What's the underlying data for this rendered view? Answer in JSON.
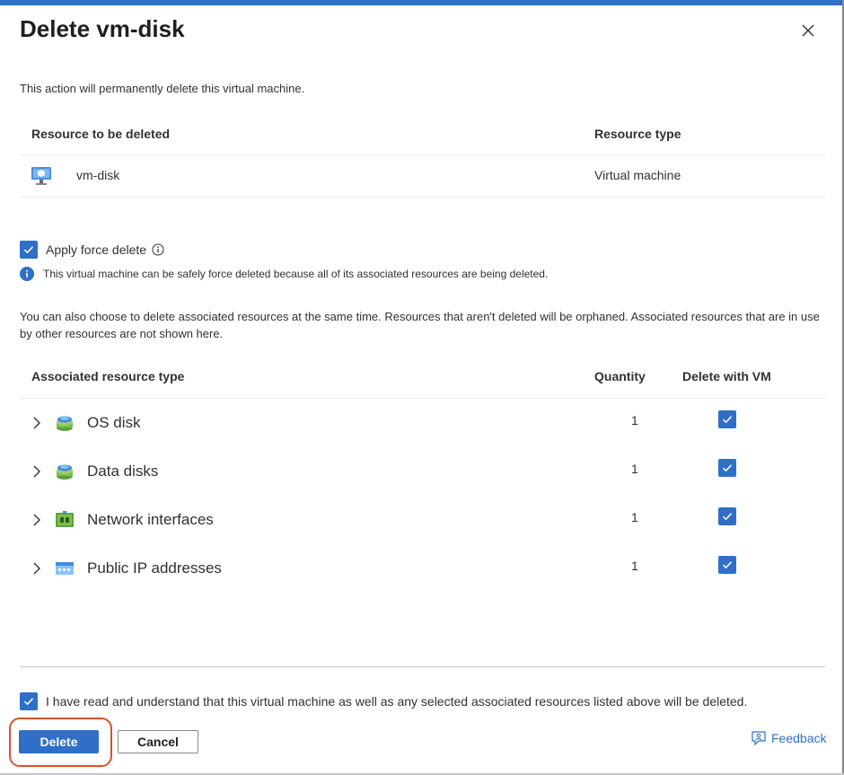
{
  "dialog": {
    "title": "Delete vm-disk",
    "intro": "This action will permanently delete this virtual machine."
  },
  "resource_table": {
    "headers": [
      "Resource to be deleted",
      "Resource type"
    ],
    "rows": [
      {
        "name": "vm-disk",
        "type": "Virtual machine",
        "icon": "virtual-machine-icon"
      }
    ]
  },
  "force_delete": {
    "label": "Apply force delete",
    "checked": true,
    "info": "This virtual machine can be safely force deleted because all of its associated resources are being deleted."
  },
  "associated": {
    "description": "You can also choose to delete associated resources at the same time. Resources that aren't deleted will be orphaned. Associated resources that are in use by other resources are not shown here.",
    "headers": [
      "Associated resource type",
      "Quantity",
      "Delete with VM"
    ],
    "rows": [
      {
        "name": "OS disk",
        "quantity": "1",
        "checked": true,
        "icon": "disk-icon"
      },
      {
        "name": "Data disks",
        "quantity": "1",
        "checked": true,
        "icon": "disk-icon"
      },
      {
        "name": "Network interfaces",
        "quantity": "1",
        "checked": true,
        "icon": "network-interface-icon"
      },
      {
        "name": "Public IP addresses",
        "quantity": "1",
        "checked": true,
        "icon": "public-ip-icon"
      }
    ]
  },
  "acknowledge": {
    "label": "I have read and understand that this virtual machine as well as any selected associated resources listed above will be deleted.",
    "checked": true
  },
  "footer": {
    "delete_label": "Delete",
    "cancel_label": "Cancel",
    "feedback_label": "Feedback"
  },
  "colors": {
    "accent": "#2f6fc7",
    "highlight_outline": "#d9512c"
  }
}
